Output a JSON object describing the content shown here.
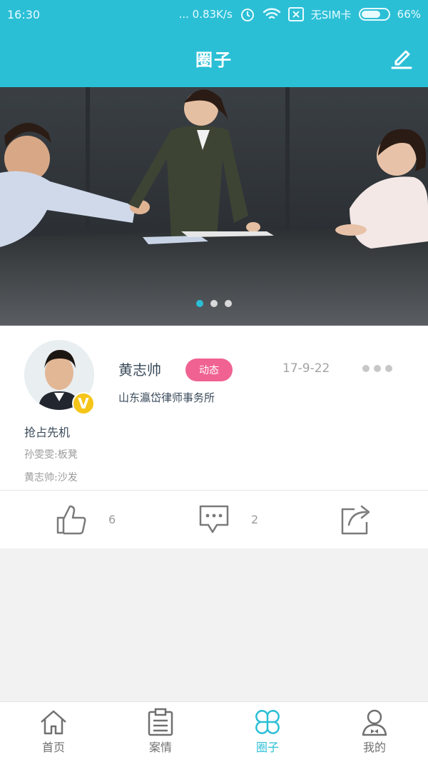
{
  "status_bar": {
    "time": "16:30",
    "network_speed": "... 0.83K/s",
    "sim_status": "无SIM卡",
    "battery": "66%"
  },
  "header": {
    "title": "圈子",
    "edit_icon": "edit-icon"
  },
  "banner": {
    "slide_count": 3,
    "active_index": 0
  },
  "post": {
    "author": "黄志帅",
    "tag": "动态",
    "date": "17-9-22",
    "organization": "山东瀛岱律师事务所",
    "verified_badge": "V",
    "content": "抢占先机",
    "replies": [
      {
        "text": "孙雯雯:板凳"
      },
      {
        "text": "黄志帅:沙发"
      }
    ],
    "likes": "6",
    "comments": "2"
  },
  "tabbar": {
    "items": [
      {
        "label": "首页",
        "icon": "home-icon"
      },
      {
        "label": "案情",
        "icon": "clipboard-icon"
      },
      {
        "label": "圈子",
        "icon": "circle-icon"
      },
      {
        "label": "我的",
        "icon": "profile-icon"
      }
    ],
    "active_color": "#2bbfd6"
  },
  "colors": {
    "primary": "#2bbfd6",
    "tag": "#f06292",
    "badge": "#f5c518"
  }
}
